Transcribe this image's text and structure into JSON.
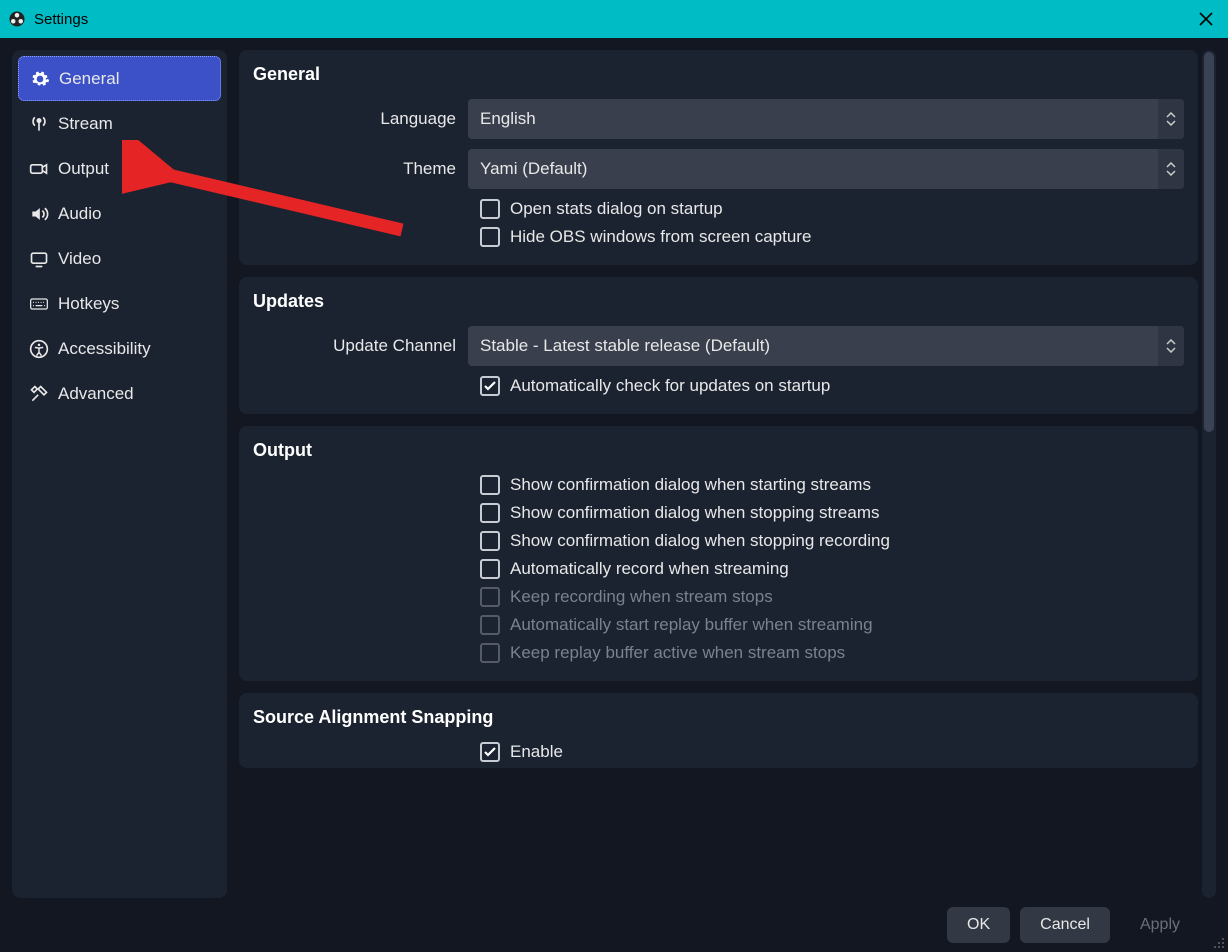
{
  "window": {
    "title": "Settings"
  },
  "sidebar": {
    "items": [
      {
        "id": "general",
        "label": "General",
        "icon": "gear-icon",
        "selected": true
      },
      {
        "id": "stream",
        "label": "Stream",
        "icon": "antenna-icon",
        "selected": false
      },
      {
        "id": "output",
        "label": "Output",
        "icon": "camera-output-icon",
        "selected": false
      },
      {
        "id": "audio",
        "label": "Audio",
        "icon": "speaker-icon",
        "selected": false
      },
      {
        "id": "video",
        "label": "Video",
        "icon": "monitor-icon",
        "selected": false
      },
      {
        "id": "hotkeys",
        "label": "Hotkeys",
        "icon": "keyboard-icon",
        "selected": false
      },
      {
        "id": "accessibility",
        "label": "Accessibility",
        "icon": "accessibility-icon",
        "selected": false
      },
      {
        "id": "advanced",
        "label": "Advanced",
        "icon": "tools-icon",
        "selected": false
      }
    ]
  },
  "sections": {
    "general": {
      "title": "General",
      "language_label": "Language",
      "language_value": "English",
      "theme_label": "Theme",
      "theme_value": "Yami (Default)",
      "check_open_stats": "Open stats dialog on startup",
      "check_hide_obs": "Hide OBS windows from screen capture"
    },
    "updates": {
      "title": "Updates",
      "channel_label": "Update Channel",
      "channel_value": "Stable - Latest stable release (Default)",
      "check_auto_update": "Automatically check for updates on startup"
    },
    "output": {
      "title": "Output",
      "check_confirm_start_stream": "Show confirmation dialog when starting streams",
      "check_confirm_stop_stream": "Show confirmation dialog when stopping streams",
      "check_confirm_stop_record": "Show confirmation dialog when stopping recording",
      "check_auto_record": "Automatically record when streaming",
      "check_keep_recording": "Keep recording when stream stops",
      "check_auto_replay": "Automatically start replay buffer when streaming",
      "check_keep_replay": "Keep replay buffer active when stream stops"
    },
    "snapping": {
      "title": "Source Alignment Snapping",
      "check_enable": "Enable"
    }
  },
  "footer": {
    "ok": "OK",
    "cancel": "Cancel",
    "apply": "Apply"
  }
}
